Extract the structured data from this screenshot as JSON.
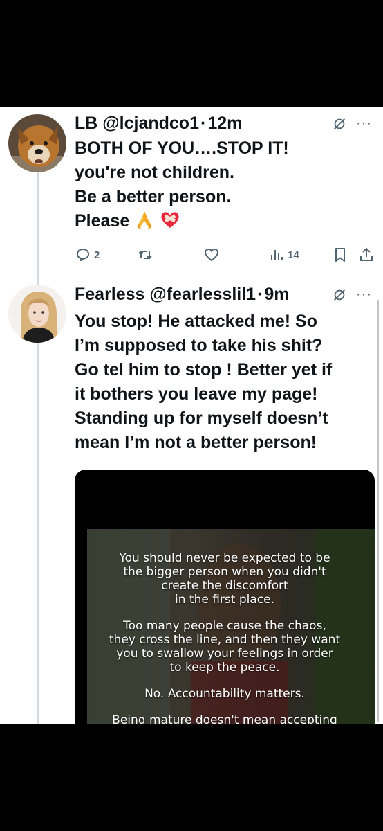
{
  "tweets": [
    {
      "name": "LB",
      "handle": "@lcjandco1",
      "separator": "·",
      "time": "12m",
      "lines": [
        "BOTH OF YOU….STOP IT!",
        "you're not children.",
        "Be a better person.",
        "Please"
      ],
      "emojis": [
        "folded-hands",
        "mending-heart"
      ],
      "actions": {
        "replies": "2",
        "reposts": "",
        "likes": "",
        "views": "14"
      }
    },
    {
      "name": "Fearless",
      "handle": "@fearlesslil1",
      "separator": "·",
      "time": "9m",
      "lines": [
        "You stop! He attacked me! So",
        "I’m supposed to take his shit?",
        "Go tel him to stop ! Better yet if",
        "it bothers you leave my page!",
        "Standing up for myself doesn’t",
        "mean I’m not a better person!"
      ],
      "media": {
        "paragraphs": [
          [
            "You should never be expected to be",
            "the bigger person when you didn't",
            "create the discomfort",
            "in the first place."
          ],
          [
            "Too many people cause the chaos,",
            "they cross the line, and then they want",
            "you to swallow your feelings in order",
            "to keep the peace."
          ],
          [
            "No. Accountability matters."
          ],
          [
            "Being mature doesn't mean accepting"
          ]
        ]
      }
    }
  ],
  "icons": {
    "grok": "grok-slash-icon",
    "more": "more-horizontal-icon",
    "reply": "reply-icon",
    "repost": "repost-icon",
    "like": "heart-icon",
    "views": "views-bar-icon",
    "bookmark": "bookmark-icon",
    "share": "share-icon"
  },
  "colors": {
    "text": "#0f1419",
    "muted": "#536471",
    "thread_line": "#cfd9de",
    "background": "#ffffff",
    "letterbox": "#000000"
  }
}
